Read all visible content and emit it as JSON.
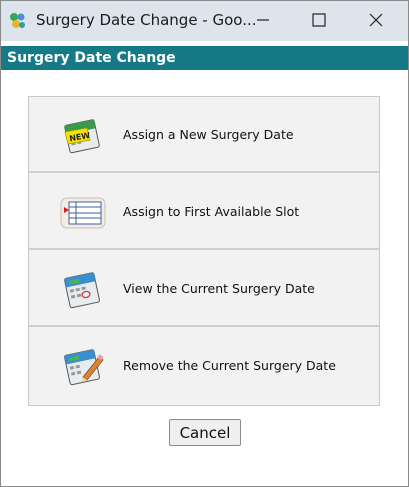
{
  "window": {
    "title": "Surgery Date Change - Goo...",
    "icon": "app-logo-icon",
    "controls": {
      "minimize_icon": "minimize-icon",
      "maximize_icon": "maximize-icon",
      "close_icon": "close-icon"
    }
  },
  "header": {
    "title": "Surgery Date Change",
    "bg_color": "#167a86"
  },
  "options": [
    {
      "label": "Assign a New Surgery Date",
      "icon": "new-calendar-icon"
    },
    {
      "label": "Assign to First Available Slot",
      "icon": "schedule-list-icon"
    },
    {
      "label": "View the Current Surgery Date",
      "icon": "view-calendar-icon"
    },
    {
      "label": "Remove the Current Surgery Date",
      "icon": "edit-calendar-icon"
    }
  ],
  "footer": {
    "cancel_label": "Cancel"
  }
}
